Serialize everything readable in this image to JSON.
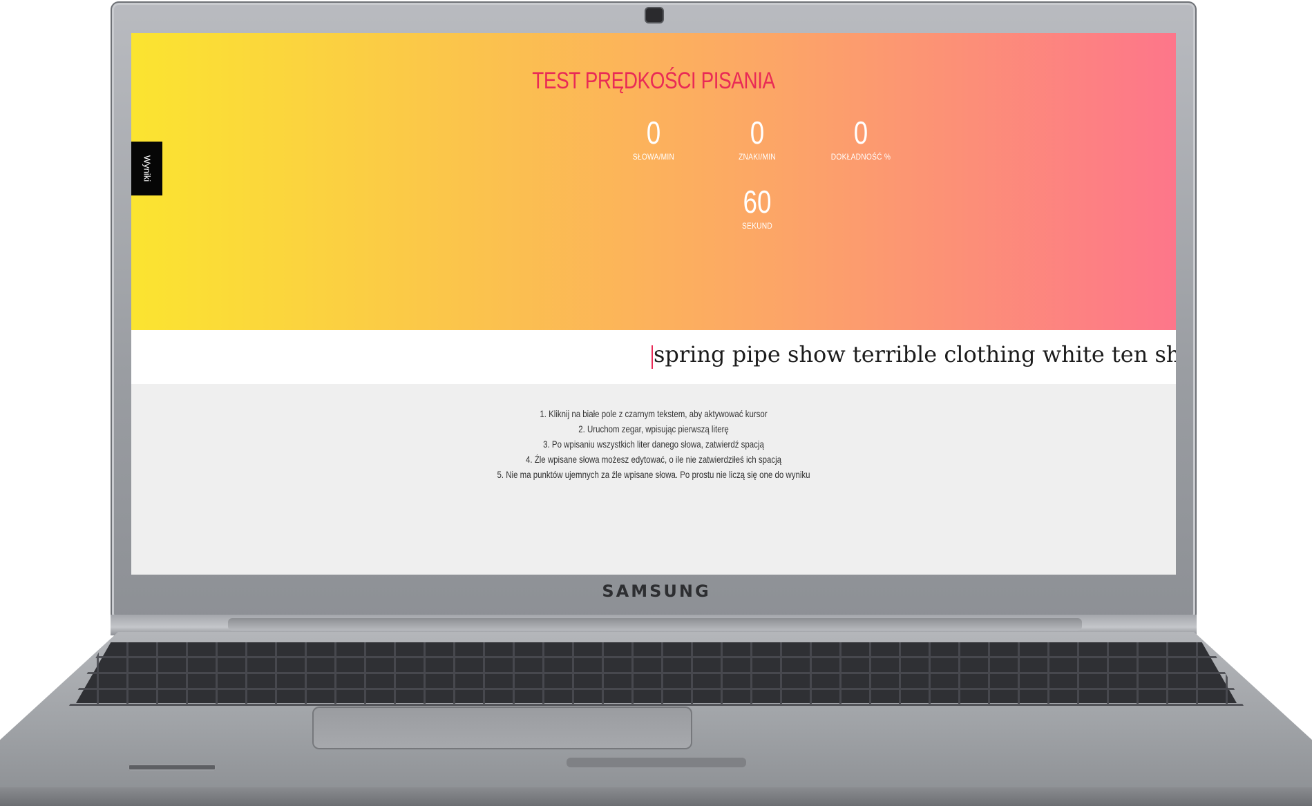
{
  "device": {
    "brand": "SAMSUNG"
  },
  "app": {
    "title": "TEST PRĘDKOŚCI PISANIA",
    "results_tab_label": "Wyniki",
    "stats": {
      "words_per_min": {
        "value": "0",
        "label": "SŁOWA/MIN"
      },
      "chars_per_min": {
        "value": "0",
        "label": "ZNAKI/MIN"
      },
      "accuracy": {
        "value": "0",
        "label": "DOKŁADNOŚĆ %"
      },
      "timer": {
        "value": "60",
        "label": "SEKUND"
      }
    },
    "typing_text": "spring pipe show terrible clothing white ten shut",
    "instructions": [
      "1. Kliknij na białe pole z czarnym tekstem, aby aktywować kursor",
      "2. Uruchom zegar, wpisując pierwszą literę",
      "3. Po wpisaniu wszystkich liter danego słowa, zatwierdź spacją",
      "4. Źle wpisane słowa możesz edytować, o ile nie zatwierdziłeś ich spacją",
      "5. Nie ma punktów ujemnych za źle wpisane słowa. Po prostu nie liczą się one do wyniku"
    ],
    "colors": {
      "title": "#e92a56",
      "gradient_start": "#fbe430",
      "gradient_end": "#fd768a",
      "caret": "#e92a56",
      "results_tab_bg": "#060606"
    }
  }
}
